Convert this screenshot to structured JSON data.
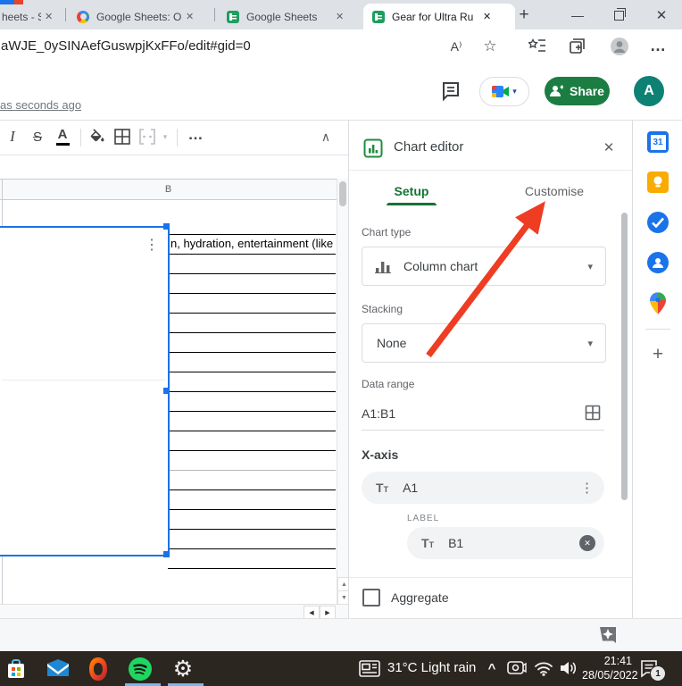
{
  "colors": {
    "accent_blue": "#1a73e8",
    "sheets_green": "#188038",
    "share_green": "#1b7d42",
    "setup_green": "#137333",
    "arrow_red": "#ee3d23",
    "avatar_teal": "#0e8174",
    "taskbar_bg": "#2c2620"
  },
  "browser": {
    "tabs": [
      {
        "title": "heets - S"
      },
      {
        "title": "Google Sheets: O"
      },
      {
        "title": "Google Sheets"
      },
      {
        "title": "Gear for Ultra Ru"
      }
    ],
    "url": "aWJE_0ySINAefGuswpjKxFFo/edit#gid=0"
  },
  "sheets": {
    "last_edit": "as seconds ago",
    "share_label": "Share",
    "avatar_letter": "A",
    "column_header": "B",
    "cell_text": "n, hydration, entertainment (like"
  },
  "chart_editor": {
    "title": "Chart editor",
    "tab_setup": "Setup",
    "tab_customise": "Customise",
    "chart_type_label": "Chart type",
    "chart_type_value": "Column chart",
    "stacking_label": "Stacking",
    "stacking_value": "None",
    "data_range_label": "Data range",
    "data_range_value": "A1:B1",
    "x_axis_label": "X-axis",
    "x_axis_value": "A1",
    "label_section": "LABEL",
    "label_value": "B1",
    "aggregate_label": "Aggregate"
  },
  "sidebar": {
    "calendar_day": "31"
  },
  "taskbar": {
    "weather": "31°C Light rain",
    "time": "21:41",
    "date": "28/05/2022",
    "notification_count": "1"
  },
  "glyphs": {
    "close": "✕",
    "new_tab": "+",
    "minimize": "—",
    "more_h": "…",
    "more_v": "⋮",
    "dropdown": "▾",
    "collapse_up": "∧",
    "chevron_right": "❯",
    "plus": "+",
    "italic": "I",
    "strikethrough": "S",
    "text_color": "A",
    "read_aloud": "A⁾",
    "star": "☆",
    "star_plus": "+",
    "tt_large": "T",
    "tt_small": "T",
    "up": "▲",
    "down": "▼",
    "left": "◀",
    "right": "▶",
    "chevron_up_tray": "^"
  }
}
